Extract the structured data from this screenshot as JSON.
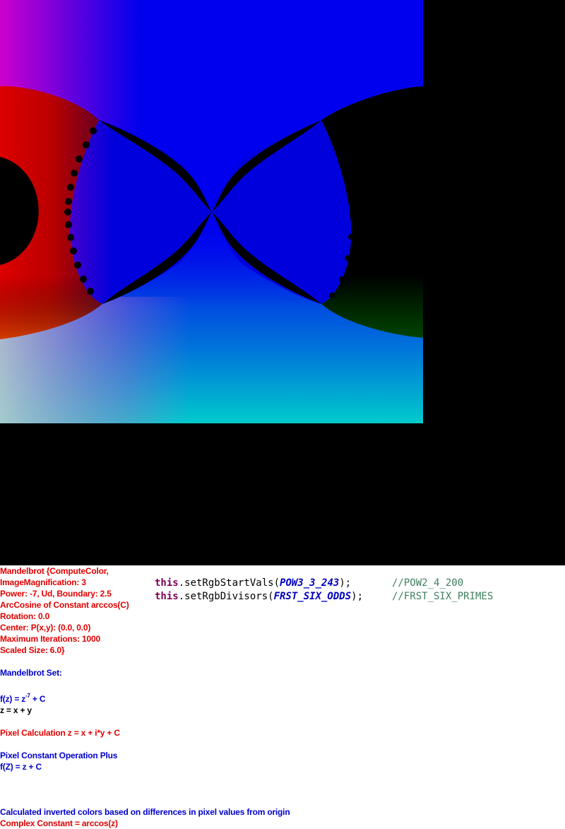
{
  "fractal": {
    "description_colors": {
      "background": "#000000",
      "top_left": "#cc00cc",
      "blue": "#0000ee",
      "red": "#cc0000",
      "cyan": "#00cccc",
      "green": "#004400"
    }
  },
  "info": {
    "line1": "Mandelbrot {ComputeColor,",
    "line2": "ImageMagnification: 3",
    "line3": "Power: -7, Ud, Boundary: 2.5",
    "line4": "ArcCosine of Constant arccos(C)",
    "line5": "Rotation: 0.0",
    "line6": "Center: P(x,y): (0.0, 0.0)",
    "line7": "Maximum Iterations: 1000",
    "line8": "Scaled Size: 6.0}",
    "set_title": "Mandelbrot Set:",
    "formula_prefix": "f(z) = z",
    "formula_exp": "-7",
    "formula_suffix": " + C",
    "z_def": "z = x + y",
    "pixel_calc": "Pixel Calculation z = x + i*y + C",
    "pixel_const_op": "Pixel Constant Operation Plus",
    "fZ": "f(Z) = z + C",
    "inverted": "Calculated inverted colors based on differences in pixel values from origin",
    "complex_const": "Complex Constant = arccos(z)"
  },
  "code": {
    "line1": {
      "keyword": "this",
      "method": ".setRgbStartVals(",
      "arg": "POW3_3_243",
      "close": ");",
      "comment": "//POW2_4_200"
    },
    "line2": {
      "keyword": "this",
      "method": ".setRgbDivisors(",
      "arg": "FRST_SIX_ODDS",
      "close": ");",
      "comment": "//FRST_SIX_PRIMES"
    }
  }
}
